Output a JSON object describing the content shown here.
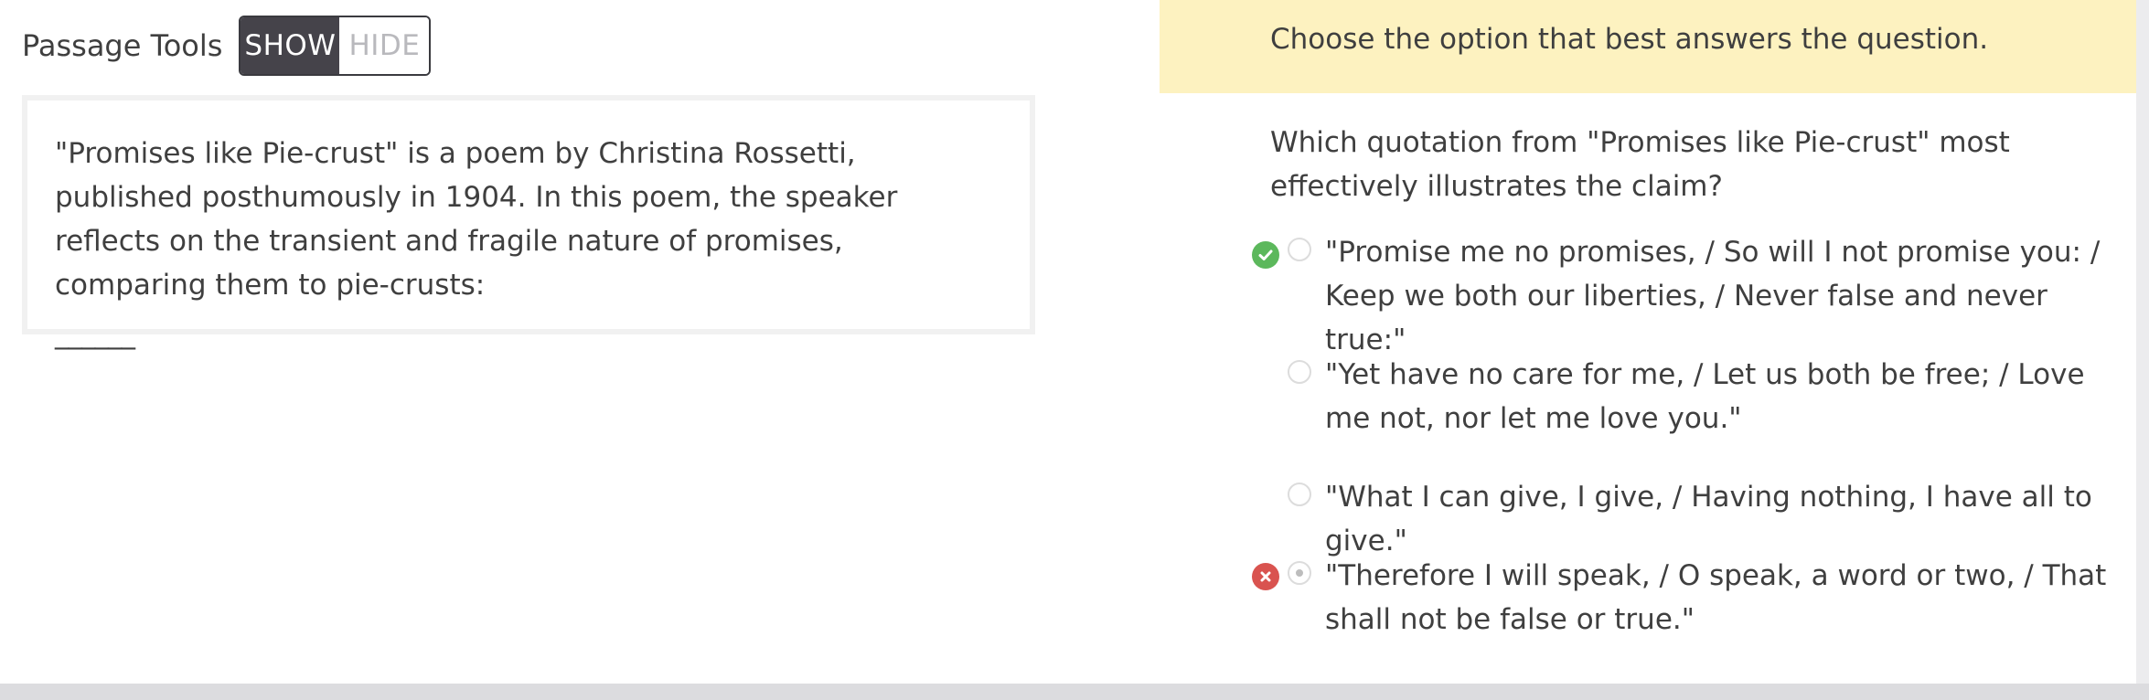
{
  "passage_tools": {
    "label": "Passage Tools",
    "show_label": "SHOW",
    "hide_label": "HIDE",
    "active": "SHOW"
  },
  "passage": {
    "text": "\"Promises like Pie-crust\" is a poem by Christina Rossetti, published posthumously in 1904. In this poem, the speaker reflects on the transient and fragile nature of promises, comparing them to pie-crusts:",
    "blank": "______"
  },
  "instruction": "Choose the option that best answers the question.",
  "question": "Which quotation from \"Promises like Pie-crust\" most effectively illustrates the claim?",
  "options": [
    {
      "text": "\"Promise me no promises, / So will I not promise you: / Keep we both our liberties, / Never false and never true:\"",
      "status": "correct",
      "selected": false
    },
    {
      "text": "\"Yet have no care for me, / Let us both be free; / Love me not, nor let me love you.\"",
      "status": "none",
      "selected": false
    },
    {
      "text": "\"What I can give, I give, / Having nothing, I have all to give.\"",
      "status": "none",
      "selected": false
    },
    {
      "text": "\"Therefore I will speak, / O speak, a word or two, / That shall not be false or true.\"",
      "status": "incorrect",
      "selected": true
    }
  ],
  "colors": {
    "instruction_bg": "#fdf2c0",
    "correct": "#5cb85c",
    "incorrect": "#d9534f",
    "toggle_active_bg": "#45434a"
  },
  "icons": {
    "correct": "check-circle-icon",
    "incorrect": "x-circle-icon"
  }
}
